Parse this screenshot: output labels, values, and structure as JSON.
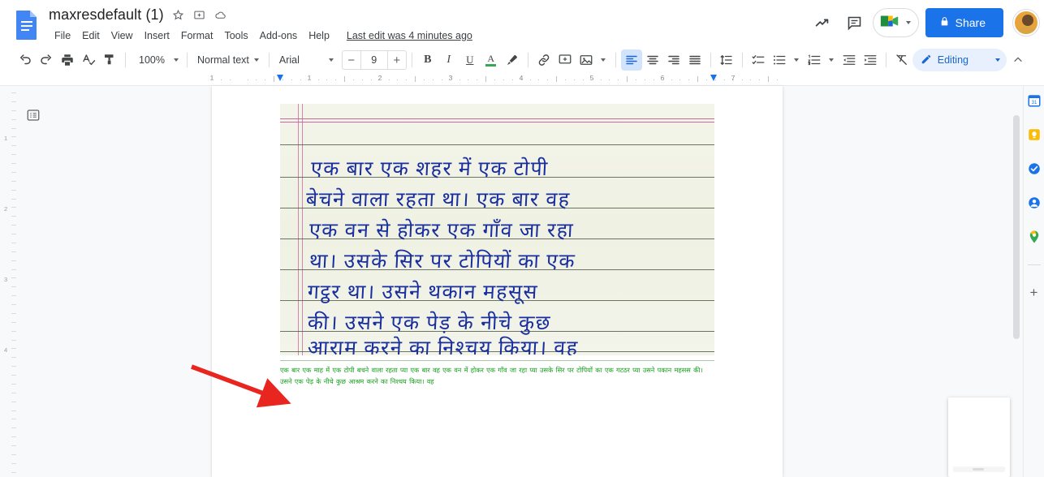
{
  "app": {
    "name": "Google Docs",
    "logo_color": "#4285f4"
  },
  "header": {
    "doc_title": "maxresdefault (1)",
    "star_icon": "star-icon",
    "move_icon": "move-to-folder-icon",
    "cloud_icon": "cloud-saved-icon",
    "menus": [
      "File",
      "Edit",
      "View",
      "Insert",
      "Format",
      "Tools",
      "Add-ons",
      "Help"
    ],
    "last_edit": "Last edit was 4 minutes ago",
    "activity_icon": "activity-trend-icon",
    "comment_icon": "comment-icon",
    "meet_label": "meet-icon",
    "share_label": "Share",
    "share_color": "#1a73e8",
    "avatar_label": "user-avatar"
  },
  "toolbar": {
    "undo": "undo-icon",
    "redo": "redo-icon",
    "print": "print-icon",
    "spellcheck": "spellcheck-icon",
    "paint_format": "paint-format-icon",
    "zoom_value": "100%",
    "style_value": "Normal text",
    "font_value": "Arial",
    "font_size": "9",
    "decrease_label": "−",
    "increase_label": "+",
    "bold": "B",
    "italic": "I",
    "underline": "U",
    "text_color": "A",
    "text_color_swatch": "#34a853",
    "highlight": "highlight-icon",
    "link": "link-icon",
    "comment": "add-comment-icon",
    "image": "insert-image-icon",
    "align_left": "align-left-icon",
    "align_center": "align-center-icon",
    "align_right": "align-right-icon",
    "align_justify": "align-justify-icon",
    "line_spacing": "line-spacing-icon",
    "checklist": "checklist-icon",
    "bulleted_list": "bulleted-list-icon",
    "numbered_list": "numbered-list-icon",
    "decrease_indent": "decrease-indent-icon",
    "increase_indent": "increase-indent-icon",
    "clear_formatting": "clear-formatting-icon",
    "mode_label": "Editing",
    "mode_icon": "pencil-icon",
    "collapse_icon": "collapse-toolbar-icon"
  },
  "ruler": {
    "numbers": [
      "1",
      "1",
      "2",
      "3",
      "4",
      "5",
      "6",
      "7"
    ],
    "left_indent_marker": "left-indent-marker",
    "right_indent_marker": "right-indent-marker"
  },
  "left_rail": {
    "outline_icon": "document-outline-icon",
    "vertical_numbers": [
      "1",
      "2",
      "3",
      "4"
    ]
  },
  "document": {
    "image_alt": "handwritten-hindi-notebook-scan",
    "handwriting_lines": [
      "एक बार एक शहर में एक टोपी",
      "बेचने वाला रहता था। एक बार वह",
      "एक वन से होकर एक गाँव जा रहा",
      "था। उसके सिर पर टोपियों का एक",
      "गट्ठर था। उसने थकान महसूस",
      "की। उसने एक पेड़ के नीचे कुछ",
      "आराम करने का निश्चय किया। वह"
    ],
    "ocr_text": "एक बार एक माह में एक टोपी बचने वाला रहता प्या एक बार वह एक वन में होकर एक गाँव जा रहा प्या उसके सिर पर टोपियों का एक गटठर प्या उसने पकान महसस की। उसने एक पेड़ के नीचे कुछ आश्रम करने का निश्चय किया। वह",
    "ocr_text_color": "#19a021",
    "annotation_arrow": "red-annotation-arrow",
    "annotation_arrow_color": "#e8251f"
  },
  "right_rail": {
    "items": [
      {
        "name": "google-calendar-icon",
        "color": "#1a73e8"
      },
      {
        "name": "google-keep-icon",
        "color": "#fbbc04"
      },
      {
        "name": "google-tasks-icon",
        "color": "#1a73e8"
      },
      {
        "name": "google-contacts-icon",
        "color": "#1a73e8"
      },
      {
        "name": "google-maps-icon",
        "color": "#34a853"
      }
    ],
    "add_on_label": "+"
  },
  "scrollbar": {
    "vertical_thumb": "vertical-scrollbar-thumb"
  }
}
